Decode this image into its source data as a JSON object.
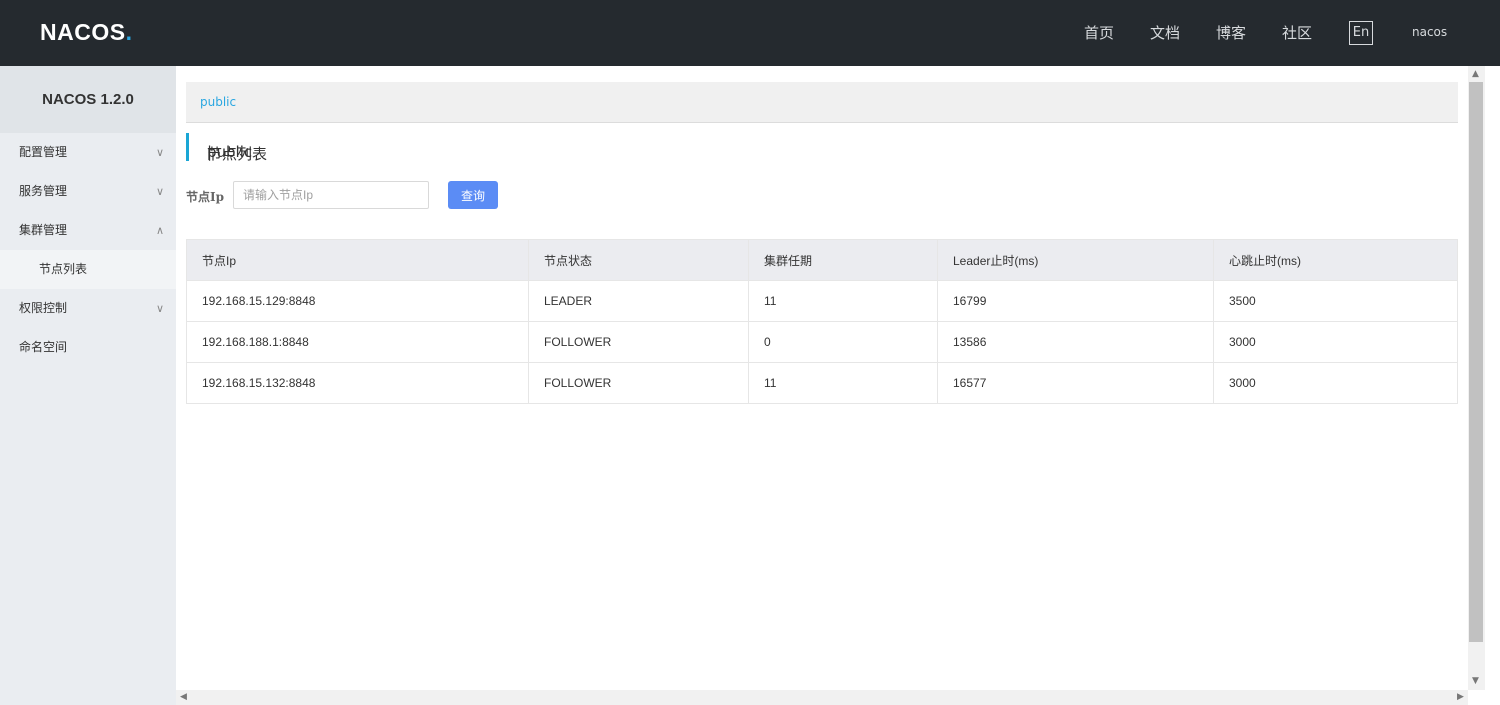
{
  "header": {
    "logo": "NACOS",
    "logo_dot": ".",
    "nav": [
      "首页",
      "文档",
      "博客",
      "社区"
    ],
    "lang": "En",
    "user": "nacos"
  },
  "sidebar": {
    "title": "NACOS 1.2.0",
    "items": [
      {
        "label": "配置管理"
      },
      {
        "label": "服务管理"
      },
      {
        "label": "集群管理"
      },
      {
        "label": "节点列表"
      },
      {
        "label": "权限控制"
      },
      {
        "label": "命名空间"
      }
    ]
  },
  "breadcrumb": "public",
  "page": {
    "title": "节点列表",
    "separator": "|",
    "namespace": "public"
  },
  "filter": {
    "label": "节点Ip",
    "placeholder": "请输入节点Ip",
    "button": "查询"
  },
  "table": {
    "headers": [
      "节点Ip",
      "节点状态",
      "集群任期",
      "Leader止时(ms)",
      "心跳止时(ms)"
    ],
    "rows": [
      [
        "192.168.15.129:8848",
        "LEADER",
        "11",
        "16799",
        "3500"
      ],
      [
        "192.168.188.1:8848",
        "FOLLOWER",
        "0",
        "13586",
        "3000"
      ],
      [
        "192.168.15.132:8848",
        "FOLLOWER",
        "11",
        "16577",
        "3000"
      ]
    ]
  },
  "icons": {
    "chevron_down": "chevron-down-icon",
    "chevron_up": "chevron-up-icon"
  },
  "colors": {
    "topbar": "#252a2f",
    "accent": "#2aa7e1",
    "button": "#5b8cf5"
  }
}
